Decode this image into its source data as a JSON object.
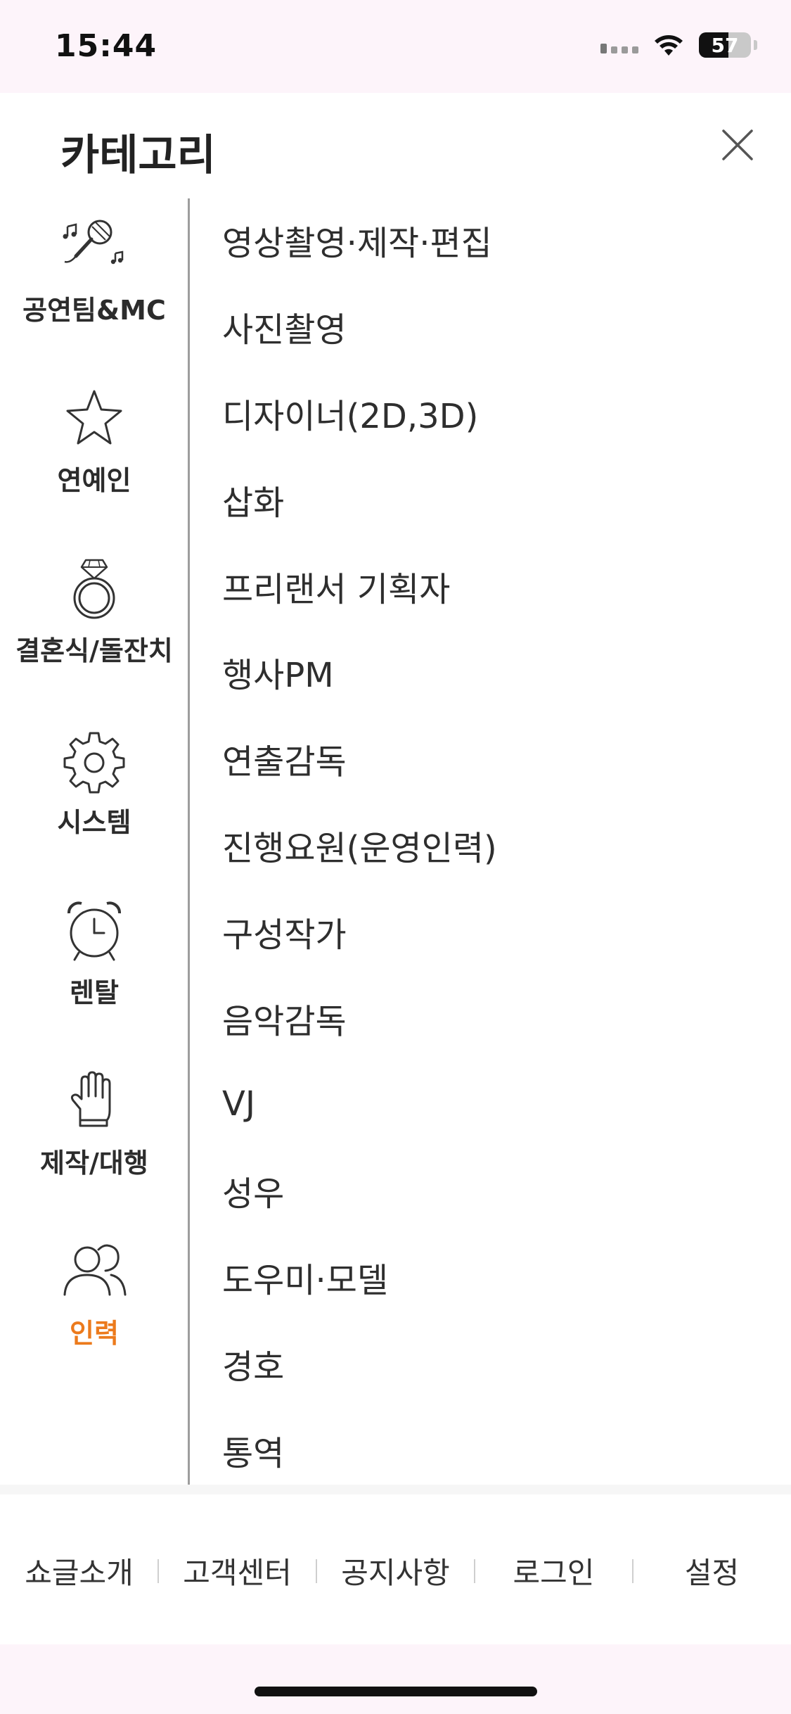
{
  "status_bar": {
    "time": "15:44",
    "battery": "57",
    "icons": [
      "signal-icon",
      "wifi-icon",
      "battery-icon"
    ]
  },
  "header": {
    "title": "카테고리",
    "close_icon": "close-icon"
  },
  "nav": {
    "active_color": "#ec7a1c",
    "items": [
      {
        "label": "공연팀&MC",
        "icon": "microphone-music-icon"
      },
      {
        "label": "연예인",
        "icon": "star-icon"
      },
      {
        "label": "결혼식/돌잔치",
        "icon": "ring-icon"
      },
      {
        "label": "시스템",
        "icon": "gear-icon"
      },
      {
        "label": "렌탈",
        "icon": "alarm-clock-icon"
      },
      {
        "label": "제작/대행",
        "icon": "glove-hand-icon"
      },
      {
        "label": "인력",
        "icon": "people-icon",
        "active": true
      }
    ]
  },
  "sub_items": [
    "영상촬영·제작·편집",
    "사진촬영",
    "디자이너(2D,3D)",
    "삽화",
    "프리랜서 기획자",
    "행사PM",
    "연출감독",
    "진행요원(운영인력)",
    "구성작가",
    "음악감독",
    "VJ",
    "성우",
    "도우미·모델",
    "경호",
    "통역"
  ],
  "footer": {
    "links": [
      "쇼글소개",
      "고객센터",
      "공지사항",
      "로그인",
      "설정"
    ]
  }
}
